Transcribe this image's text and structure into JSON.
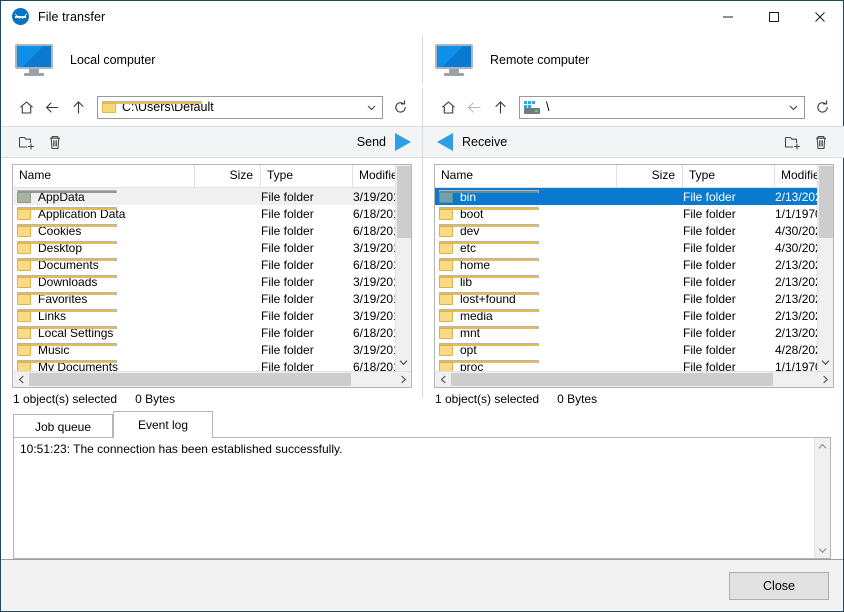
{
  "window": {
    "title": "File transfer",
    "logo_icon": "teamviewer-logo-icon",
    "minimize_icon": "minimize-icon",
    "maximize_icon": "maximize-icon",
    "close_icon": "close-icon"
  },
  "local": {
    "header_label": "Local computer",
    "monitor_icon": "monitor-icon",
    "home_icon": "home-icon",
    "back_icon": "back-arrow-icon",
    "up_icon": "up-arrow-icon",
    "path": "C:\\Users\\Default",
    "path_icon": "folder-icon",
    "dropdown_icon": "chevron-down-icon",
    "refresh_icon": "refresh-icon",
    "new_folder_icon": "new-folder-icon",
    "delete_icon": "trash-icon",
    "transfer_label": "Send",
    "transfer_icon": "arrow-right-icon",
    "columns": [
      "Name",
      "Size",
      "Type",
      "Modified"
    ],
    "rows": [
      {
        "name": "AppData",
        "size": "",
        "type": "File folder",
        "modified": "3/19/201",
        "icon": "folder-hidden-icon",
        "state": "hover"
      },
      {
        "name": "Application Data",
        "size": "",
        "type": "File folder",
        "modified": "6/18/201",
        "icon": "folder-icon",
        "state": "normal"
      },
      {
        "name": "Cookies",
        "size": "",
        "type": "File folder",
        "modified": "6/18/201",
        "icon": "folder-icon",
        "state": "normal"
      },
      {
        "name": "Desktop",
        "size": "",
        "type": "File folder",
        "modified": "3/19/201",
        "icon": "folder-icon",
        "state": "normal"
      },
      {
        "name": "Documents",
        "size": "",
        "type": "File folder",
        "modified": "6/18/201",
        "icon": "folder-icon",
        "state": "normal"
      },
      {
        "name": "Downloads",
        "size": "",
        "type": "File folder",
        "modified": "3/19/201",
        "icon": "folder-icon",
        "state": "normal"
      },
      {
        "name": "Favorites",
        "size": "",
        "type": "File folder",
        "modified": "3/19/201",
        "icon": "folder-icon",
        "state": "normal"
      },
      {
        "name": "Links",
        "size": "",
        "type": "File folder",
        "modified": "3/19/201",
        "icon": "folder-icon",
        "state": "normal"
      },
      {
        "name": "Local Settings",
        "size": "",
        "type": "File folder",
        "modified": "6/18/201",
        "icon": "folder-icon",
        "state": "normal"
      },
      {
        "name": "Music",
        "size": "",
        "type": "File folder",
        "modified": "3/19/201",
        "icon": "folder-icon",
        "state": "normal"
      },
      {
        "name": "My Documents",
        "size": "",
        "type": "File folder",
        "modified": "6/18/201",
        "icon": "folder-icon",
        "state": "normal"
      }
    ],
    "status_selected": "1 object(s) selected",
    "status_size": "0 Bytes"
  },
  "remote": {
    "header_label": "Remote computer",
    "monitor_icon": "monitor-icon",
    "home_icon": "home-icon",
    "back_icon": "back-arrow-icon",
    "up_icon": "up-arrow-icon",
    "path": "\\",
    "path_icon": "server-icon",
    "dropdown_icon": "chevron-down-icon",
    "refresh_icon": "refresh-icon",
    "new_folder_icon": "new-folder-icon",
    "delete_icon": "trash-icon",
    "transfer_label": "Receive",
    "transfer_icon": "arrow-left-icon",
    "columns": [
      "Name",
      "Size",
      "Type",
      "Modified"
    ],
    "rows": [
      {
        "name": "bin",
        "size": "",
        "type": "File folder",
        "modified": "2/13/202",
        "icon": "folder-selected-icon",
        "state": "selected"
      },
      {
        "name": "boot",
        "size": "",
        "type": "File folder",
        "modified": "1/1/1970",
        "icon": "folder-icon",
        "state": "normal"
      },
      {
        "name": "dev",
        "size": "",
        "type": "File folder",
        "modified": "4/30/202",
        "icon": "folder-icon",
        "state": "normal"
      },
      {
        "name": "etc",
        "size": "",
        "type": "File folder",
        "modified": "4/30/202",
        "icon": "folder-icon",
        "state": "normal"
      },
      {
        "name": "home",
        "size": "",
        "type": "File folder",
        "modified": "2/13/202",
        "icon": "folder-icon",
        "state": "normal"
      },
      {
        "name": "lib",
        "size": "",
        "type": "File folder",
        "modified": "2/13/202",
        "icon": "folder-icon",
        "state": "normal"
      },
      {
        "name": "lost+found",
        "size": "",
        "type": "File folder",
        "modified": "2/13/202",
        "icon": "folder-icon",
        "state": "normal"
      },
      {
        "name": "media",
        "size": "",
        "type": "File folder",
        "modified": "2/13/202",
        "icon": "folder-icon",
        "state": "normal"
      },
      {
        "name": "mnt",
        "size": "",
        "type": "File folder",
        "modified": "2/13/202",
        "icon": "folder-icon",
        "state": "normal"
      },
      {
        "name": "opt",
        "size": "",
        "type": "File folder",
        "modified": "4/28/202",
        "icon": "folder-icon",
        "state": "normal"
      },
      {
        "name": "proc",
        "size": "",
        "type": "File folder",
        "modified": "1/1/1970",
        "icon": "folder-icon",
        "state": "normal"
      }
    ],
    "status_selected": "1 object(s) selected",
    "status_size": "0 Bytes"
  },
  "log": {
    "tabs": [
      {
        "label": "Job queue",
        "active": false
      },
      {
        "label": "Event log",
        "active": true
      }
    ],
    "entries": [
      "10:51:23: The connection has been established successfully."
    ]
  },
  "footer": {
    "close_label": "Close"
  },
  "colors": {
    "accent": "#0a7ad0",
    "arrow_blue": "#2f9fe5",
    "selection_blue": "#0a7ad0",
    "window_border": "#1c4a5a",
    "toolbar_bg": "#f2f4f6",
    "folder_yellow": "#fada84"
  }
}
